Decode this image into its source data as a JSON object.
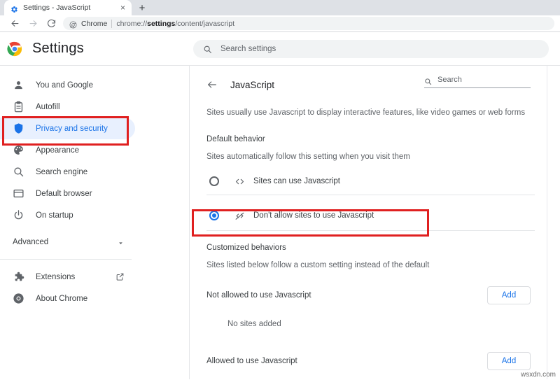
{
  "browser": {
    "tab": {
      "title": "Settings - JavaScript",
      "favicon": "settings-gear-icon",
      "close_label": "×"
    },
    "new_tab_label": "+",
    "nav": {
      "back": "←",
      "forward": "→",
      "reload": "↻"
    },
    "omnibox": {
      "scheme_label": "Chrome",
      "url_prefix": "chrome://",
      "url_bold": "settings",
      "url_suffix": "/content/javascript",
      "full_url": "chrome://settings/content/javascript"
    }
  },
  "settings_header": {
    "title": "Settings",
    "logo": "chrome-logo-icon",
    "search": {
      "placeholder": "Search settings",
      "value": ""
    }
  },
  "sidebar": {
    "items": [
      {
        "label": "You and Google",
        "icon": "person-icon",
        "selected": false
      },
      {
        "label": "Autofill",
        "icon": "clipboard-icon",
        "selected": false
      },
      {
        "label": "Privacy and security",
        "icon": "shield-icon",
        "selected": true
      },
      {
        "label": "Appearance",
        "icon": "palette-icon",
        "selected": false
      },
      {
        "label": "Search engine",
        "icon": "magnifier-icon",
        "selected": false
      },
      {
        "label": "Default browser",
        "icon": "browser-window-icon",
        "selected": false
      },
      {
        "label": "On startup",
        "icon": "power-icon",
        "selected": false
      }
    ],
    "advanced": {
      "label": "Advanced",
      "icon": "chevron-down-icon"
    },
    "footer_items": [
      {
        "label": "Extensions",
        "icon": "puzzle-icon",
        "trailing_icon": "external-link-icon"
      },
      {
        "label": "About Chrome",
        "icon": "chrome-logo-icon",
        "trailing_icon": ""
      }
    ]
  },
  "content": {
    "back_icon": "back-arrow-icon",
    "title": "JavaScript",
    "search": {
      "placeholder": "Search",
      "value": "",
      "icon": "search-icon"
    },
    "intro": "Sites usually use Javascript to display interactive features, like video games or web forms",
    "default_behavior": {
      "heading": "Default behavior",
      "description": "Sites automatically follow this setting when you visit them",
      "options": [
        {
          "label": "Sites can use Javascript",
          "icon": "code-icon",
          "selected": false
        },
        {
          "label": "Don't allow sites to use Javascript",
          "icon": "code-slashed-icon",
          "selected": true
        }
      ]
    },
    "customized_behaviors": {
      "heading": "Customized behaviors",
      "description": "Sites listed below follow a custom setting instead of the default",
      "groups": [
        {
          "label": "Not allowed to use Javascript",
          "add_label": "Add",
          "empty_text": "No sites added"
        },
        {
          "label": "Allowed to use Javascript",
          "add_label": "Add",
          "empty_text": ""
        }
      ]
    }
  },
  "annotations": {
    "color": "#e02020",
    "boxes": [
      {
        "name": "sidebar-privacy-and-security-highlight"
      },
      {
        "name": "dont-allow-javascript-highlight"
      }
    ]
  },
  "watermark": "wsxdn.com",
  "colors": {
    "accent_blue": "#1a73e8",
    "selected_bg": "#e8f0fe",
    "chrome_bg": "#dee1e6",
    "annotation_red": "#e02020"
  }
}
